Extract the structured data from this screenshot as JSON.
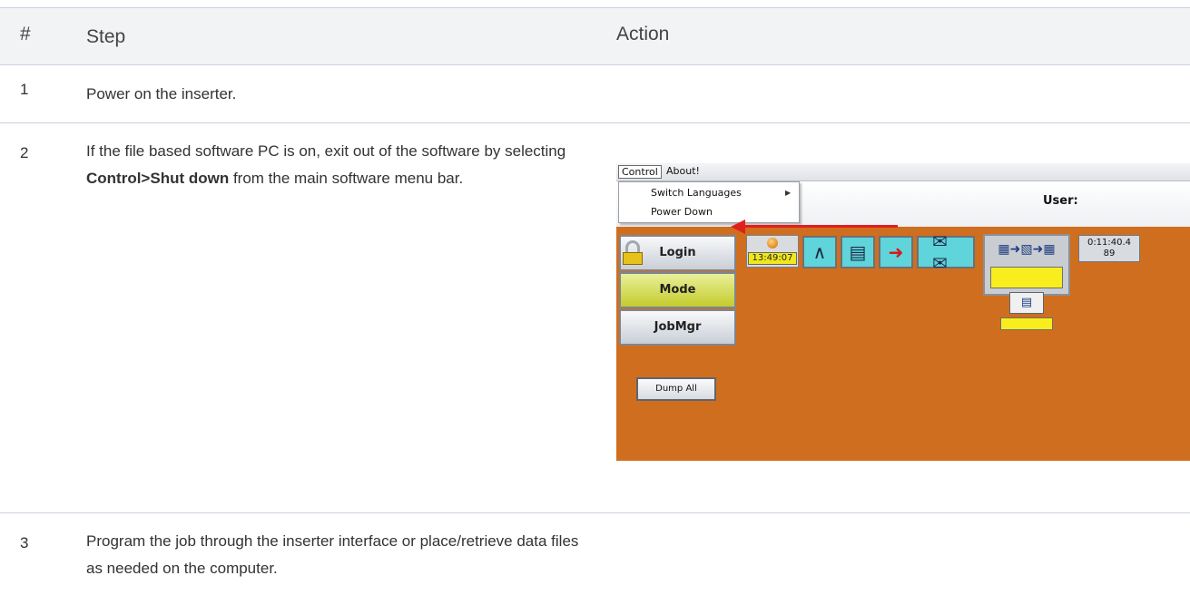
{
  "table": {
    "header": {
      "num": "#",
      "step": "Step",
      "action": "Action"
    },
    "rows": [
      {
        "num": "1",
        "step": "Power on the inserter."
      },
      {
        "num": "2",
        "step_pre": "If the file based software PC is on, exit out of the software by selecting ",
        "step_bold": "Control>Shut down",
        "step_post": " from the main software menu bar."
      },
      {
        "num": "3",
        "step": "Program the job through the inserter interface or place/retrieve data files as needed on the computer."
      }
    ]
  },
  "screenshot": {
    "menu": {
      "control": "Control",
      "about": "About!"
    },
    "dropdown": {
      "switch_languages": "Switch Languages",
      "power_down": "Power Down"
    },
    "user_label": "User:",
    "buttons": {
      "login": "Login",
      "mode": "Mode",
      "jobmgr": "JobMgr",
      "dump_all": "Dump All"
    },
    "clock": "13:49:07",
    "timer": {
      "elapsed": "0:11:40.4",
      "count": "89"
    },
    "colors": {
      "background": "#d06e1f",
      "arrow": "#e0201c",
      "mode_button": "#c4cc2c",
      "display_yellow": "#f8ee1e",
      "icon_button": "#5fd4da"
    },
    "icons": [
      "lock-icon",
      "status-led-icon",
      "compass-icon",
      "printer-icon",
      "feed-arrow-icon",
      "envelopes-icon",
      "file-transfer-icon",
      "document-icon"
    ]
  }
}
